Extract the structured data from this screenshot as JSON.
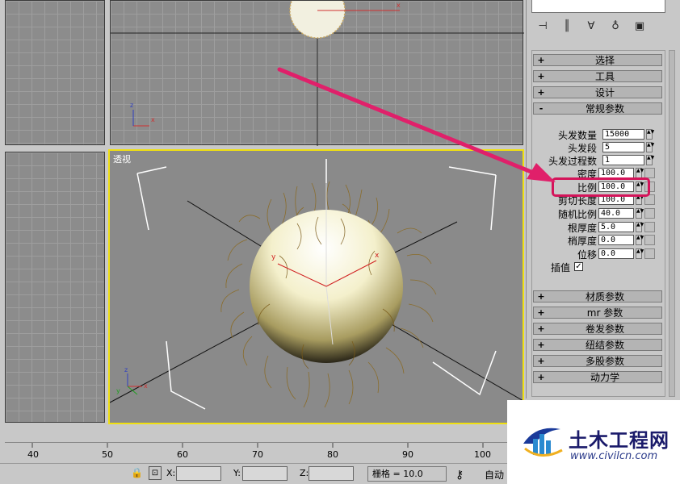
{
  "viewports": {
    "perspective_label": "透视"
  },
  "command_panel": {
    "rollouts_top": [
      {
        "sign": "+",
        "title": "选择"
      },
      {
        "sign": "+",
        "title": "工具"
      },
      {
        "sign": "+",
        "title": "设计"
      },
      {
        "sign": "-",
        "title": "常规参数"
      }
    ],
    "params": [
      {
        "label": "头发数量",
        "value": "15000"
      },
      {
        "label": "头发段",
        "value": "5"
      },
      {
        "label": "头发过程数",
        "value": "1"
      },
      {
        "label": "密度",
        "value": "100.0"
      },
      {
        "label": "比例",
        "value": "100.0"
      },
      {
        "label": "剪切长度",
        "value": "100.0"
      },
      {
        "label": "随机比例",
        "value": "40.0"
      },
      {
        "label": "根厚度",
        "value": "5.0"
      },
      {
        "label": "梢厚度",
        "value": "0.0"
      },
      {
        "label": "位移",
        "value": "0.0"
      }
    ],
    "interpolate_label": "插值",
    "interpolate_checked": "✓",
    "rollouts_bottom": [
      {
        "sign": "+",
        "title": "材质参数"
      },
      {
        "sign": "+",
        "title": "mr 参数"
      },
      {
        "sign": "+",
        "title": "卷发参数"
      },
      {
        "sign": "+",
        "title": "纽结参数"
      },
      {
        "sign": "+",
        "title": "多股参数"
      },
      {
        "sign": "+",
        "title": "动力学"
      }
    ]
  },
  "timeline": {
    "ticks": [
      "40",
      "50",
      "60",
      "70",
      "80",
      "90",
      "100"
    ]
  },
  "statusbar": {
    "x_label": "X:",
    "y_label": "Y:",
    "z_label": "Z:",
    "grid_text": "栅格 = 10.0",
    "auto_key": "自动"
  },
  "watermark": {
    "title": "土木工程网",
    "url": "www.civilcn.com"
  },
  "colors": {
    "active_viewport_border": "#f0e010",
    "highlight_box": "#d4145a",
    "arrow": "#e0206a"
  }
}
